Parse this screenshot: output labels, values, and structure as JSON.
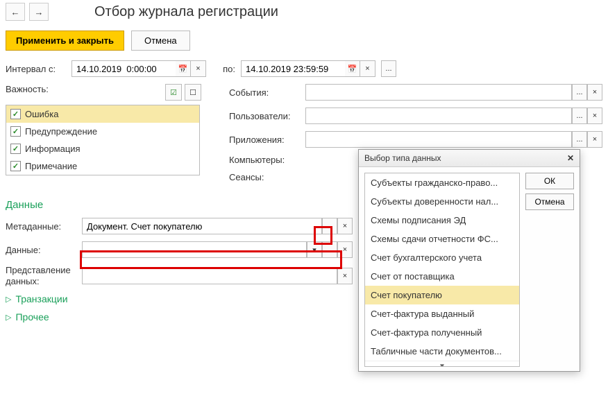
{
  "header": {
    "title": "Отбор журнала регистрации"
  },
  "toolbar": {
    "apply_close": "Применить и закрыть",
    "cancel": "Отмена"
  },
  "interval": {
    "from_label": "Интервал с:",
    "from_value": "14.10.2019  0:00:00",
    "to_label": "по:",
    "to_value": "14.10.2019 23:59:59"
  },
  "severity": {
    "label": "Важность:",
    "items": [
      "Ошибка",
      "Предупреждение",
      "Информация",
      "Примечание"
    ]
  },
  "filters": {
    "events": "События:",
    "users": "Пользователи:",
    "apps": "Приложения:",
    "computers": "Компьютеры:",
    "sessions": "Сеансы:"
  },
  "data_section": {
    "title": "Данные",
    "metadata_label": "Метаданные:",
    "metadata_value": "Документ. Счет покупателю",
    "data_label": "Данные:",
    "data_value": "",
    "presentation_label": "Представление данных:"
  },
  "transactions": "Транзакции",
  "other": "Прочее",
  "dialog": {
    "title": "Выбор типа данных",
    "ok": "ОК",
    "cancel": "Отмена",
    "items": [
      "Субъекты гражданско-право...",
      "Субъекты доверенности нал...",
      "Схемы подписания ЭД",
      "Схемы сдачи отчетности ФС...",
      "Счет бухгалтерского учета",
      "Счет от поставщика",
      "Счет покупателю",
      "Счет-фактура выданный",
      "Счет-фактура полученный",
      "Табличные части документов..."
    ]
  },
  "icons": {
    "calendar": "📅",
    "clear": "×",
    "dots": "...",
    "dropdown": "▾",
    "check": "✓",
    "toggle_all": "☑",
    "toggle_none": "☐"
  }
}
